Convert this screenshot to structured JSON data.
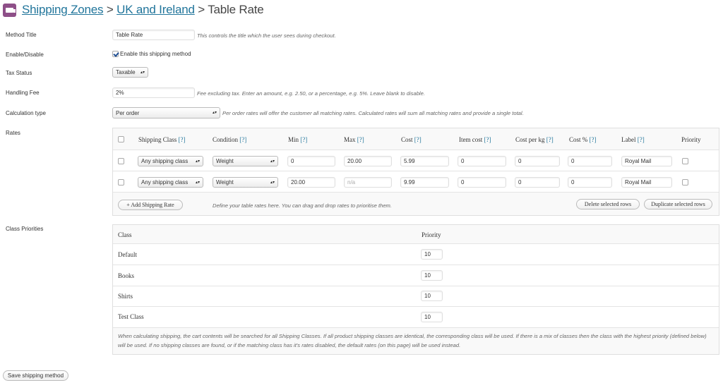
{
  "header": {
    "crumb1": "Shipping Zones",
    "sep1": ">",
    "crumb2": "UK and Ireland",
    "sep2": ">",
    "current": "Table Rate",
    "icon": "truck-icon"
  },
  "method_title": {
    "label": "Method Title",
    "value": "Table Rate",
    "desc": "This controls the title which the user sees during checkout."
  },
  "enable": {
    "label": "Enable/Disable",
    "checkbox_label": "Enable this shipping method",
    "checked": true
  },
  "tax": {
    "label": "Tax Status",
    "value": "Taxable"
  },
  "handling": {
    "label": "Handling Fee",
    "value": "2%",
    "desc": "Fee excluding tax. Enter an amount, e.g. 2.50, or a percentage, e.g. 5%. Leave blank to disable."
  },
  "calc": {
    "label": "Calculation type",
    "value": "Per order",
    "desc": "Per order rates will offer the customer all matching rates. Calculated rates will sum all matching rates and provide a single total."
  },
  "rates": {
    "label": "Rates",
    "columns": {
      "shipping_class": "Shipping Class",
      "condition": "Condition",
      "min": "Min",
      "max": "Max",
      "cost": "Cost",
      "item_cost": "Item cost",
      "cost_per_kg": "Cost per kg",
      "cost_pct": "Cost %",
      "label": "Label",
      "priority": "Priority",
      "help": "[?]"
    },
    "rows": [
      {
        "shipping_class": "Any shipping class",
        "condition": "Weight",
        "min": "0",
        "max": "20.00",
        "cost": "5.99",
        "item_cost": "0",
        "cost_per_kg": "0",
        "cost_pct": "0",
        "label": "Royal Mail"
      },
      {
        "shipping_class": "Any shipping class",
        "condition": "Weight",
        "min": "20.00",
        "max": "n/a",
        "cost": "9.99",
        "item_cost": "0",
        "cost_per_kg": "0",
        "cost_pct": "0",
        "label": "Royal Mail"
      }
    ],
    "add_button": "+ Add Shipping Rate",
    "footer_desc": "Define your table rates here. You can drag and drop rates to prioritise them.",
    "delete_button": "Delete selected rows",
    "duplicate_button": "Duplicate selected rows"
  },
  "priorities": {
    "label": "Class Priorities",
    "col_class": "Class",
    "col_priority": "Priority",
    "rows": [
      {
        "class": "Default",
        "priority": "10"
      },
      {
        "class": "Books",
        "priority": "10"
      },
      {
        "class": "Shirts",
        "priority": "10"
      },
      {
        "class": "Test Class",
        "priority": "10"
      }
    ],
    "note": "When calculating shipping, the cart contents will be searched for all Shipping Classes. If all product shipping classes are identical, the corresponding class will be used. If there is a mix of classes then the class with the highest priority (defined below) will be used. If no shipping classes are found, or if the matching class has it's rates disabled, the default rates (on this page) will be used instead."
  },
  "save_button": "Save shipping method",
  "colors": {
    "link": "#21759b",
    "icon_bg": "#8e4f88"
  }
}
